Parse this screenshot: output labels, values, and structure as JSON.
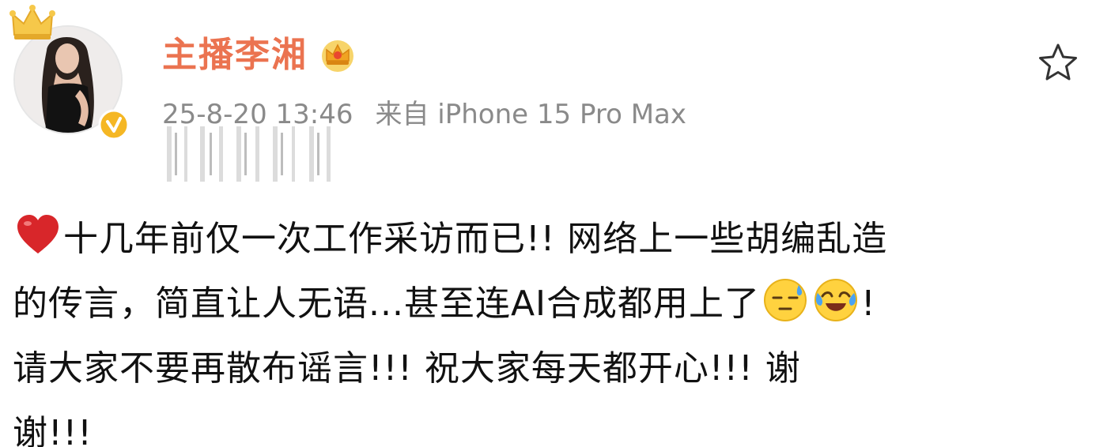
{
  "post": {
    "author": {
      "name": "主播李湘",
      "avatar_icon": "avatar-photo",
      "crown_icon": "crown-icon",
      "verified_icon": "verified-icon",
      "vip_badge_icon": "vip-crown-badge-icon",
      "name_color": "#eb7350"
    },
    "meta": {
      "timestamp": "25-8-20 13:46",
      "source": "来自 iPhone 15 Pro Max"
    },
    "favorite_icon": "star-icon",
    "body": {
      "line1_text": "十几年前仅一次工作采访而已!! 网络上一些胡编乱造",
      "line2_text": "的传言，简直让人无语...甚至连AI合成都用上了",
      "line2_end": "!",
      "line3_text": "请大家不要再散布谣言!!! 祝大家每天都开心!!! 谢",
      "line4_text": "谢!!!",
      "lead_icon": "red-heart-icon",
      "emoji_1": "sweat-face-emoji",
      "emoji_2": "laughing-crying-emoji"
    }
  }
}
